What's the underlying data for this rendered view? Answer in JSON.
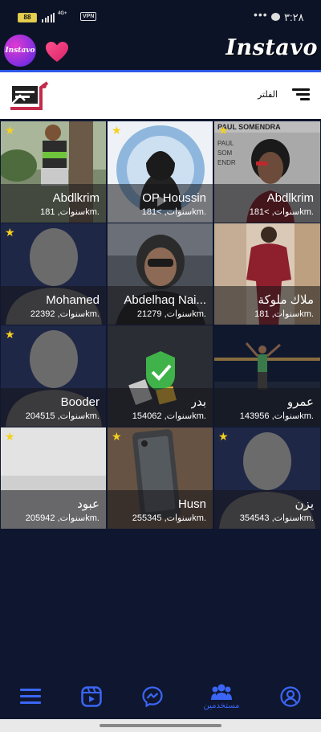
{
  "status_bar": {
    "battery": "88",
    "network": "4G+",
    "vpn": "VPN",
    "time": "٣:٢٨"
  },
  "header": {
    "logo_text": "Instavo",
    "brand": "Instavo"
  },
  "filter_bar": {
    "label": "الفلتر"
  },
  "users": [
    {
      "name": "Abdlkrim",
      "meta": "18سنوات, 1km.",
      "starred": true
    },
    {
      "name": "OP Houssin",
      "meta": "18سنوات, >1km.",
      "starred": true
    },
    {
      "name": "Abdlkrim",
      "meta": "18سنوات, >1km.",
      "starred": true
    },
    {
      "name": "Mohamed",
      "meta": "22سنوات, 392km.",
      "starred": true
    },
    {
      "name": "Abdelhaq Nai...",
      "meta": "21سنوات, 279km.",
      "starred": false
    },
    {
      "name": "ملاك ملوكة",
      "meta": "18سنوات, 1km.",
      "starred": false
    },
    {
      "name": "Booder",
      "meta": "20سنوات, 4515km.",
      "starred": true
    },
    {
      "name": "بدر",
      "meta": "15سنوات, 4062km.",
      "starred": false
    },
    {
      "name": "عمرو",
      "meta": "14سنوات, 3956km.",
      "starred": false
    },
    {
      "name": "عبود",
      "meta": "20سنوات, 5942km.",
      "starred": true
    },
    {
      "name": "Husn",
      "meta": "25سنوات, 5345km.",
      "starred": true
    },
    {
      "name": "يزن",
      "meta": "35سنوات, 4543km.",
      "starred": true
    }
  ],
  "bottom_nav": {
    "users_label": "مستخدمين"
  },
  "colors": {
    "background": "#0f1730",
    "accent": "#2e56e8",
    "nav_icon": "#3b66f5",
    "star": "#f5d020"
  }
}
